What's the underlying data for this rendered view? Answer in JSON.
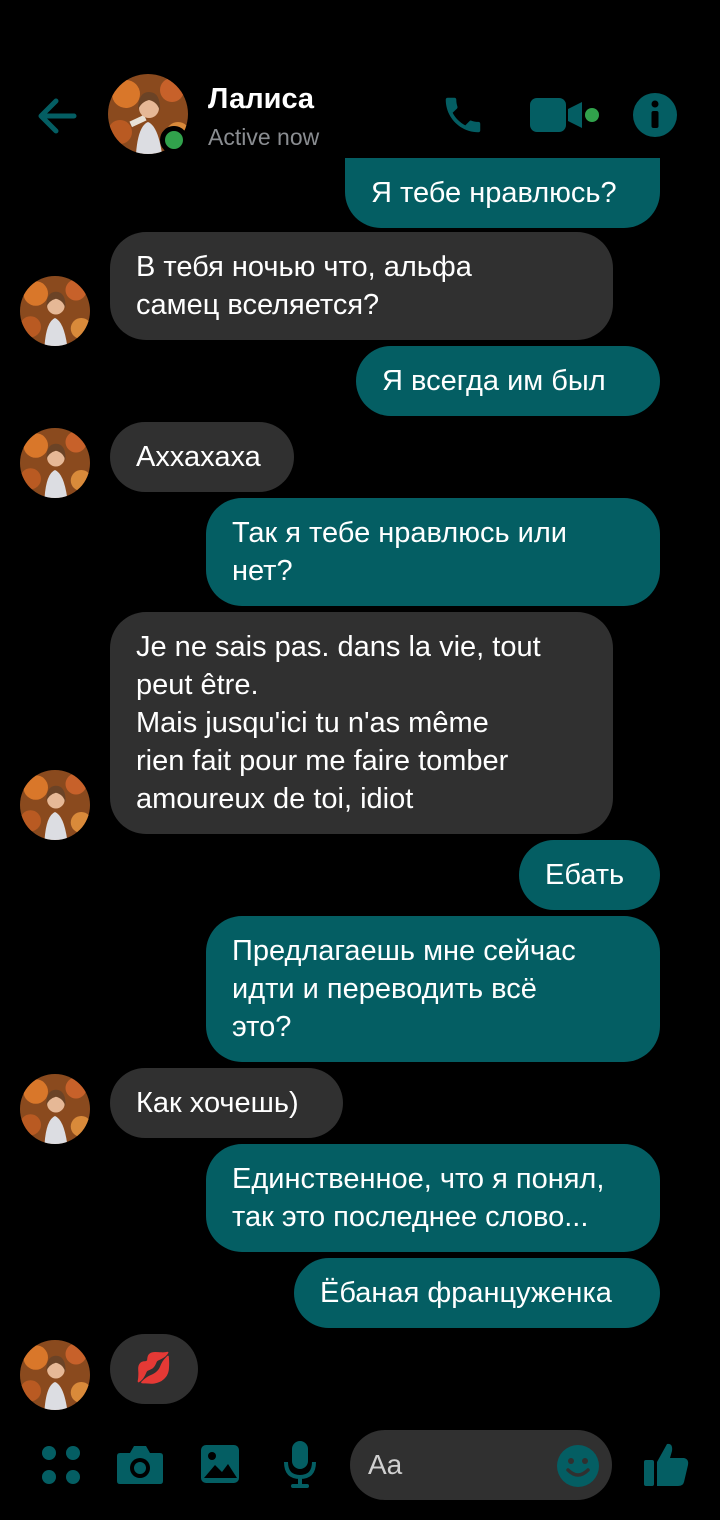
{
  "header": {
    "contact_name": "Лалиса",
    "status": "Active now"
  },
  "colors": {
    "accent": "#045e63",
    "incoming_bubble": "#303030",
    "online": "#31a24c",
    "background": "#000000"
  },
  "icons": {
    "back": "arrow-left-icon",
    "call": "phone-icon",
    "video": "video-camera-icon",
    "info": "info-icon",
    "more": "grid-dots-icon",
    "camera": "camera-icon",
    "gallery": "image-icon",
    "voice": "microphone-icon",
    "emoji": "emoji-icon",
    "like": "thumbs-up-icon"
  },
  "messages": [
    {
      "direction": "out",
      "text": "Я тебе нравлюсь?"
    },
    {
      "direction": "in",
      "text": "В тебя ночью что, альфа\nсамец вселяется?"
    },
    {
      "direction": "out",
      "text": "Я всегда им был"
    },
    {
      "direction": "in",
      "text": "Аххахаха"
    },
    {
      "direction": "out",
      "text": "Так я тебе нравлюсь или\nнет?"
    },
    {
      "direction": "in",
      "text": "Je ne sais pas. dans la vie, tout\npeut être.\nMais jusqu'ici tu n'as même\nrien fait pour me faire tomber\namoureux de toi, idiot"
    },
    {
      "direction": "out",
      "text": "Ебать"
    },
    {
      "direction": "out",
      "text": "Предлагаешь мне сейчас\nидти и переводить всё\nэто?"
    },
    {
      "direction": "in",
      "text": "Как хочешь)"
    },
    {
      "direction": "out",
      "text": "Единственное, что я понял,\nтак это последнее слово..."
    },
    {
      "direction": "out",
      "text": "Ёбаная француженка"
    },
    {
      "direction": "in",
      "text": "💋"
    }
  ],
  "composer": {
    "placeholder": "Aa"
  }
}
